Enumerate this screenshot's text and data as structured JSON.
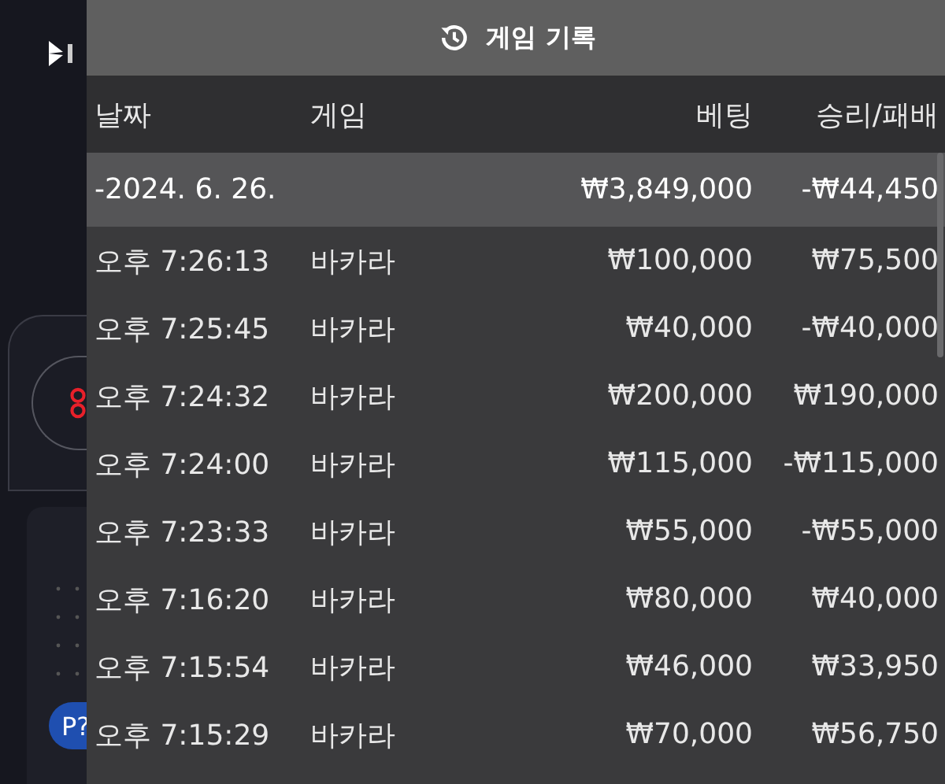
{
  "background_app": {
    "badge": "P?"
  },
  "panel": {
    "title": "게임 기록",
    "columns": [
      "날짜",
      "게임",
      "베팅",
      "승리/패배"
    ],
    "group": {
      "date": "-2024. 6. 26.",
      "bet": "₩3,849,000",
      "result": "-₩44,450"
    },
    "rows": [
      {
        "time": "오후 7:26:13",
        "game": "바카라",
        "bet": "₩100,000",
        "result": "₩75,500"
      },
      {
        "time": "오후 7:25:45",
        "game": "바카라",
        "bet": "₩40,000",
        "result": "-₩40,000"
      },
      {
        "time": "오후 7:24:32",
        "game": "바카라",
        "bet": "₩200,000",
        "result": "₩190,000"
      },
      {
        "time": "오후 7:24:00",
        "game": "바카라",
        "bet": "₩115,000",
        "result": "-₩115,000"
      },
      {
        "time": "오후 7:23:33",
        "game": "바카라",
        "bet": "₩55,000",
        "result": "-₩55,000"
      },
      {
        "time": "오후 7:16:20",
        "game": "바카라",
        "bet": "₩80,000",
        "result": "₩40,000"
      },
      {
        "time": "오후 7:15:54",
        "game": "바카라",
        "bet": "₩46,000",
        "result": "₩33,950"
      },
      {
        "time": "오후 7:15:29",
        "game": "바카라",
        "bet": "₩70,000",
        "result": "₩56,750"
      }
    ]
  }
}
